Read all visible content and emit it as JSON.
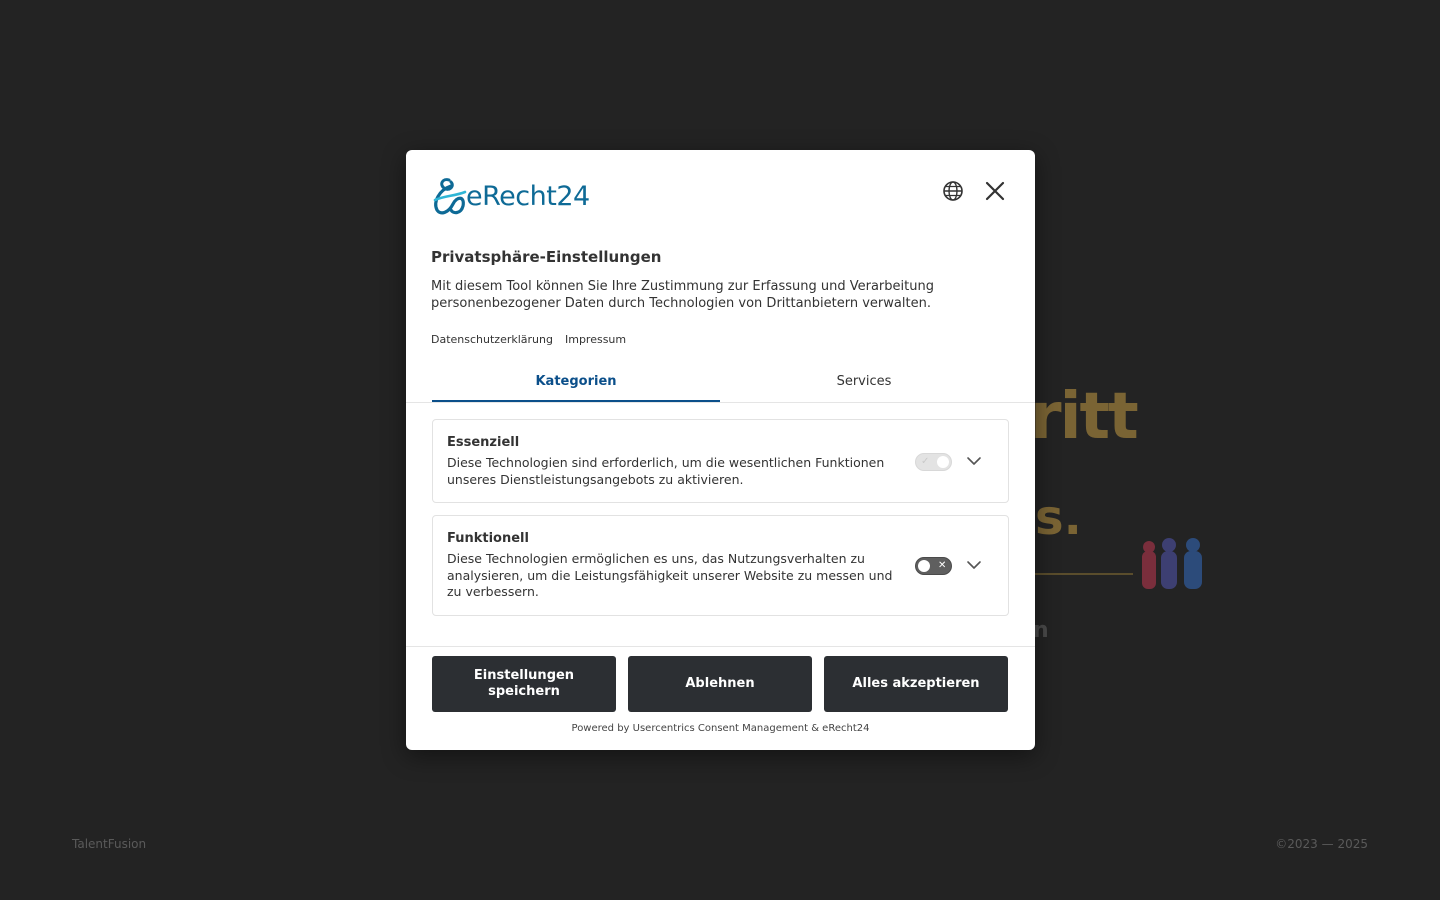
{
  "background": {
    "hero_fragment": "ritt",
    "hero_fragment2": "s.",
    "sub_fragment": "n",
    "footer_left": "TalentFusion",
    "footer_right": "©2023 — 2025"
  },
  "dialog": {
    "logo_text": "eRecht24",
    "title": "Privatsphäre-Einstellungen",
    "description": "Mit diesem Tool können Sie Ihre Zustimmung zur Erfassung und Verarbeitung personenbezogener Daten durch Technologien von Drittanbietern verwalten.",
    "links": {
      "privacy": "Datenschutzerklärung",
      "imprint": "Impressum"
    },
    "tabs": [
      {
        "label": "Kategorien",
        "active": true
      },
      {
        "label": "Services",
        "active": false
      }
    ],
    "categories": [
      {
        "title": "Essenziell",
        "description": "Diese Technologien sind erforderlich, um die wesentlichen Funktionen unseres Dienstleistungsangebots zu aktivieren.",
        "toggle_state": "on-disabled"
      },
      {
        "title": "Funktionell",
        "description": "Diese Technologien ermöglichen es uns, das Nutzungsverhalten zu analysieren, um die Leistungsfähigkeit unserer Website zu messen und zu verbessern.",
        "toggle_state": "off"
      }
    ],
    "buttons": {
      "save": "Einstellungen speichern",
      "deny": "Ablehnen",
      "accept": "Alles akzeptieren"
    },
    "powered_by": "Powered by Usercentrics Consent Management & eRecht24"
  },
  "colors": {
    "overlay_bg": "#232323",
    "accent_blue": "#0b4f8a",
    "logo_blue": "#0e6a96",
    "button_dark": "#2c2f33"
  },
  "icons": {
    "language": "globe-icon",
    "close": "close-icon",
    "expand": "chevron-down-icon"
  }
}
